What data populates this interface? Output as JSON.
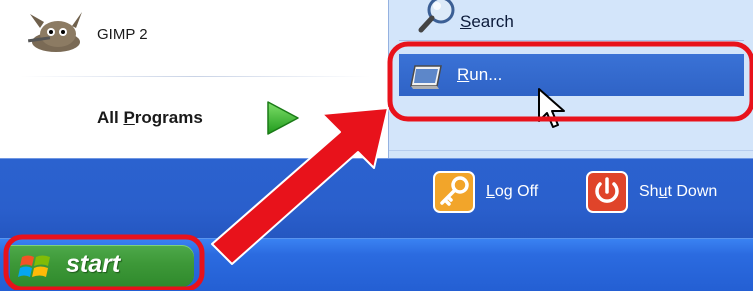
{
  "programs": {
    "gimp_label": "GIMP 2",
    "all_programs_label_pre": "All ",
    "all_programs_label_u": "P",
    "all_programs_label_post": "rograms"
  },
  "places": {
    "search_label_u": "S",
    "search_label_rest": "earch",
    "run_label_u": "R",
    "run_label_rest": "un..."
  },
  "session": {
    "logoff_label_u": "L",
    "logoff_label_rest": "og Off",
    "shutdown_label_pre": "Sh",
    "shutdown_label_u": "u",
    "shutdown_label_rest": "t Down"
  },
  "taskbar": {
    "start_label": "start"
  },
  "colors": {
    "highlight": "#2f63c6",
    "annotation_red": "#e8121b",
    "start_green": "#3d9838"
  },
  "icons": [
    "gimp-icon",
    "green-arrow-icon",
    "search-icon",
    "run-icon",
    "cursor-icon",
    "logoff-key-icon",
    "shutdown-power-icon",
    "windows-flag-icon"
  ]
}
